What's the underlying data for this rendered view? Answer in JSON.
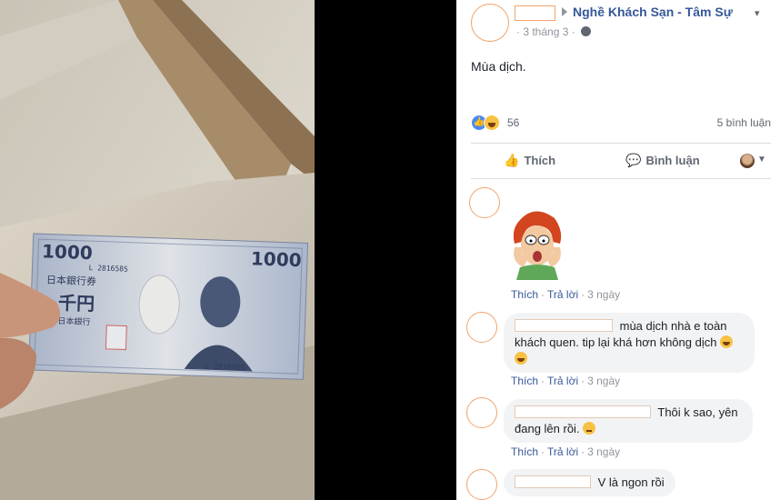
{
  "photo": {
    "banknote_denomination": "1000",
    "banknote_kanji_top": "日本銀行券",
    "banknote_kanji_main": "千円",
    "banknote_kanji_sub": "日本銀行",
    "banknote_serial": "L 281658S"
  },
  "post": {
    "group_name": "Nghề Khách Sạn - Tâm Sự",
    "time": "3 tháng 3",
    "time_sep": "·",
    "text": "Mùa dịch.",
    "reaction_count": "56",
    "comment_count": "5 bình luận",
    "like_button": "Thích",
    "comment_button": "Bình luận"
  },
  "comments": [
    {
      "text": "",
      "like": "Thích",
      "reply": "Trả lời",
      "time": "3 ngày"
    },
    {
      "text": "mùa dịch nhà e toàn khách quen. tip lại khá hơn không dịch",
      "like": "Thích",
      "reply": "Trả lời",
      "time": "3 ngày"
    },
    {
      "text": "Thôi k sao, yên đang lên rồi.",
      "like": "Thích",
      "reply": "Trả lời",
      "time": "3 ngày"
    },
    {
      "text": "V là ngon rồi"
    }
  ],
  "icons": {
    "like": "like-reaction-icon",
    "haha": "haha-reaction-icon",
    "globe": "globe-icon",
    "thumb": "thumb-up-icon",
    "comment": "speech-bubble-icon"
  },
  "colors": {
    "link": "#365899",
    "accent_blue": "#4b8af5",
    "muted": "#90949c",
    "bubble": "#f2f3f5"
  }
}
